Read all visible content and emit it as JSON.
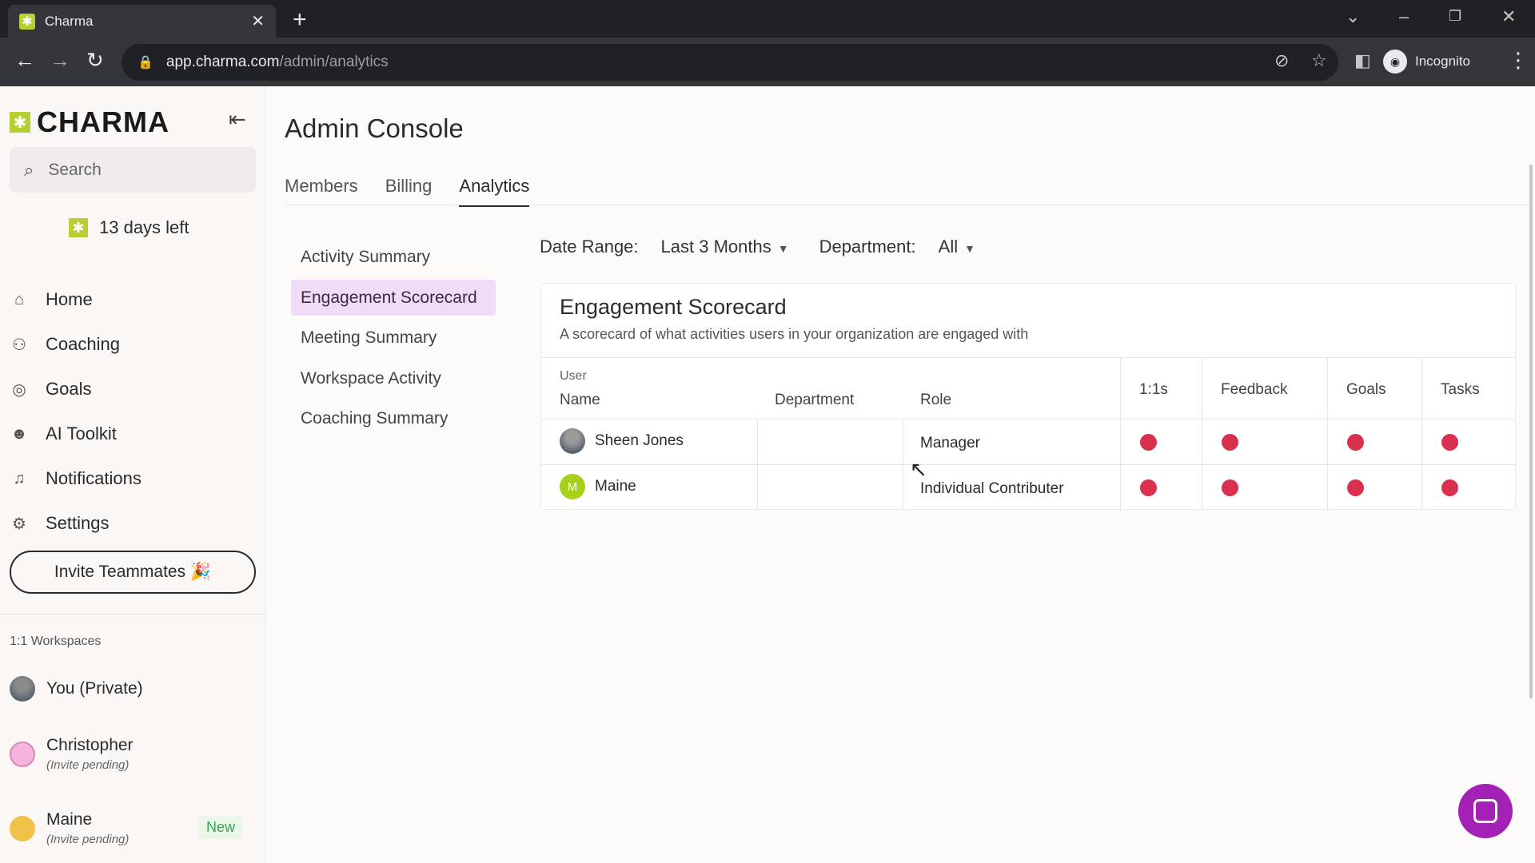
{
  "browser": {
    "tab_title": "Charma",
    "url_host": "app.charma.com",
    "url_path": "/admin/analytics",
    "profile_label": "Incognito"
  },
  "sidebar": {
    "brand": "CHARMA",
    "search_placeholder": "Search",
    "trial": "13 days left",
    "nav": [
      {
        "label": "Home",
        "icon": "home-icon"
      },
      {
        "label": "Coaching",
        "icon": "coaching-icon"
      },
      {
        "label": "Goals",
        "icon": "goals-icon"
      },
      {
        "label": "AI Toolkit",
        "icon": "robot-icon"
      },
      {
        "label": "Notifications",
        "icon": "bell-icon"
      },
      {
        "label": "Settings",
        "icon": "gear-icon"
      }
    ],
    "invite_label": "Invite Teammates 🎉",
    "workspaces_label": "1:1 Workspaces",
    "workspaces": [
      {
        "name": "You (Private)",
        "sub": ""
      },
      {
        "name": "Christopher",
        "sub": "(Invite pending)"
      },
      {
        "name": "Maine",
        "sub": "(Invite pending)",
        "badge": "New"
      }
    ]
  },
  "main": {
    "title": "Admin Console",
    "tabs": [
      "Members",
      "Billing",
      "Analytics"
    ],
    "active_tab": "Analytics",
    "subnav": [
      "Activity Summary",
      "Engagement Scorecard",
      "Meeting Summary",
      "Workspace Activity",
      "Coaching Summary"
    ],
    "active_subnav": "Engagement Scorecard",
    "filters": {
      "date_label": "Date Range:",
      "date_value": "Last 3 Months",
      "dept_label": "Department:",
      "dept_value": "All"
    },
    "card": {
      "title": "Engagement Scorecard",
      "subtitle": "A scorecard of what activities users in your organization are engaged with",
      "group_header": "User",
      "columns": [
        "Name",
        "Department",
        "Role",
        "1:1s",
        "Feedback",
        "Goals",
        "Tasks"
      ],
      "rows": [
        {
          "name": "Sheen Jones",
          "department": "",
          "role": "Manager",
          "initial": ""
        },
        {
          "name": "Maine",
          "department": "",
          "role": "Individual Contributer",
          "initial": "M"
        }
      ]
    }
  },
  "colors": {
    "accent": "#b7cf33",
    "active_subnav_bg": "#f0dcf8",
    "status_dot": "#d8304e",
    "chat_button": "#a421b6"
  }
}
